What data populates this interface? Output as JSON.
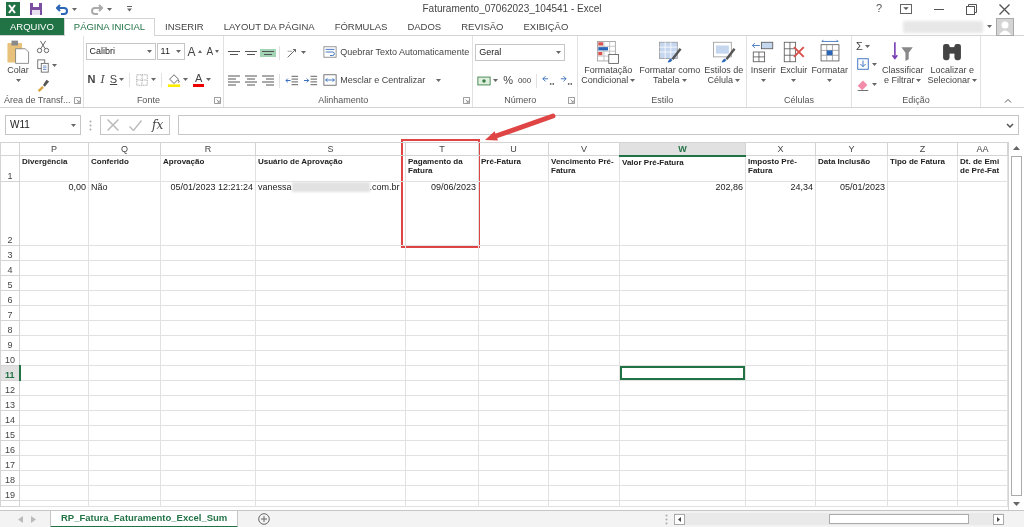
{
  "window": {
    "title": "Faturamento_07062023_104541 - Excel",
    "help": "?"
  },
  "tabs": [
    {
      "label": "ARQUIVO",
      "kind": "file",
      "selected": false
    },
    {
      "label": "PÁGINA INICIAL",
      "kind": "tab",
      "selected": true
    },
    {
      "label": "INSERIR",
      "kind": "tab",
      "selected": false
    },
    {
      "label": "LAYOUT DA PÁGINA",
      "kind": "tab",
      "selected": false
    },
    {
      "label": "FÓRMULAS",
      "kind": "tab",
      "selected": false
    },
    {
      "label": "DADOS",
      "kind": "tab",
      "selected": false
    },
    {
      "label": "REVISÃO",
      "kind": "tab",
      "selected": false
    },
    {
      "label": "EXIBIÇÃO",
      "kind": "tab",
      "selected": false
    }
  ],
  "ribbon": {
    "groups": [
      {
        "label": "Área de Transf...",
        "launcher": true,
        "blocks": [
          {
            "kind": "big",
            "lines": [
              "Colar"
            ],
            "caret": true
          },
          {
            "kind": "stack",
            "rows": [
              {
                "items": [
                  {
                    "kind": "icon"
                  }
                ]
              },
              {
                "items": [
                  {
                    "kind": "icon",
                    "caret": true
                  }
                ]
              },
              {
                "items": [
                  {
                    "kind": "icon"
                  }
                ]
              }
            ]
          }
        ]
      },
      {
        "label": "Fonte",
        "launcher": true,
        "blocks": [
          {
            "kind": "stack",
            "rows": [
              {
                "items": [
                  {
                    "kind": "combo",
                    "value": "Calibri"
                  },
                  {
                    "kind": "combo",
                    "value": "11"
                  },
                  {
                    "kind": "grow",
                    "label": "A"
                  },
                  {
                    "kind": "shrink",
                    "label": "A"
                  }
                ]
              },
              {
                "items": [
                  {
                    "kind": "bold",
                    "label": "N"
                  },
                  {
                    "kind": "italic",
                    "label": "I"
                  },
                  {
                    "kind": "underline",
                    "label": "S",
                    "caret": true
                  },
                  {
                    "kind": "sep"
                  },
                  {
                    "kind": "icon",
                    "caret": true
                  },
                  {
                    "kind": "sep"
                  },
                  {
                    "kind": "icon",
                    "caret": true
                  },
                  {
                    "kind": "fontcolor",
                    "label": "A",
                    "caret": true
                  }
                ]
              }
            ]
          }
        ]
      },
      {
        "label": "Alinhamento",
        "launcher": true,
        "blocks": [
          {
            "kind": "stack",
            "rows": [
              {
                "items": [
                  {
                    "kind": "icon",
                    "selected": false
                  },
                  {
                    "kind": "icon",
                    "selected": false
                  },
                  {
                    "kind": "icon",
                    "selected": true
                  },
                  {
                    "kind": "sep"
                  },
                  {
                    "kind": "icon",
                    "caret": true
                  }
                ]
              },
              {
                "items": [
                  {
                    "kind": "icon",
                    "selected": false
                  },
                  {
                    "kind": "icon",
                    "selected": false
                  },
                  {
                    "kind": "icon",
                    "selected": false
                  },
                  {
                    "kind": "sep"
                  },
                  {
                    "kind": "icon"
                  },
                  {
                    "kind": "icon"
                  }
                ]
              }
            ]
          },
          {
            "kind": "stack",
            "rows": [
              {
                "items": [
                  {
                    "kind": "wide",
                    "label": "Quebrar Texto Automaticamente"
                  }
                ]
              },
              {
                "items": [
                  {
                    "kind": "wide",
                    "label": "Mesclar e Centralizar",
                    "caret": true
                  }
                ]
              }
            ]
          }
        ]
      },
      {
        "label": "Número",
        "launcher": true,
        "blocks": [
          {
            "kind": "stack",
            "rows": [
              {
                "items": [
                  {
                    "kind": "combo",
                    "value": "Geral"
                  }
                ]
              },
              {
                "items": [
                  {
                    "kind": "icon",
                    "caret": true
                  },
                  {
                    "kind": "glyph",
                    "label": "%"
                  },
                  {
                    "kind": "small",
                    "label": "000"
                  },
                  {
                    "kind": "sep"
                  },
                  {
                    "kind": "icon"
                  },
                  {
                    "kind": "icon"
                  }
                ]
              }
            ]
          }
        ]
      },
      {
        "label": "Estilo",
        "blocks": [
          {
            "kind": "big",
            "lines": [
              "Formatação",
              "Condicional"
            ],
            "caret": true
          },
          {
            "kind": "big",
            "lines": [
              "Formatar como",
              "Tabela"
            ],
            "caret": true
          },
          {
            "kind": "big",
            "lines": [
              "Estilos de",
              "Célula"
            ],
            "caret": true
          }
        ]
      },
      {
        "label": "Células",
        "blocks": [
          {
            "kind": "big",
            "lines": [
              "Inserir"
            ],
            "caret": true
          },
          {
            "kind": "big",
            "lines": [
              "Excluir"
            ],
            "caret": true
          },
          {
            "kind": "big",
            "lines": [
              "Formatar"
            ],
            "caret": true
          }
        ]
      },
      {
        "label": "Edição",
        "blocks": [
          {
            "kind": "stack",
            "rows": [
              {
                "items": [
                  {
                    "kind": "glyph",
                    "label": "Σ",
                    "caret": true
                  }
                ]
              },
              {
                "items": [
                  {
                    "kind": "icon",
                    "caret": true
                  }
                ]
              },
              {
                "items": [
                  {
                    "kind": "icon",
                    "caret": true
                  }
                ]
              }
            ]
          },
          {
            "kind": "big",
            "lines": [
              "Classificar",
              "e Filtrar"
            ],
            "caret": true
          },
          {
            "kind": "big",
            "lines": [
              "Localizar e",
              "Selecionar"
            ],
            "caret": true
          }
        ]
      }
    ]
  },
  "formula_bar": {
    "name_box": "W11",
    "fx": "fx"
  },
  "sheet": {
    "columns": [
      {
        "letter": "P",
        "selected": false
      },
      {
        "letter": "Q",
        "selected": false
      },
      {
        "letter": "R",
        "selected": false
      },
      {
        "letter": "S",
        "selected": false
      },
      {
        "letter": "T",
        "selected": false
      },
      {
        "letter": "U",
        "selected": false
      },
      {
        "letter": "V",
        "selected": false
      },
      {
        "letter": "W",
        "selected": true
      },
      {
        "letter": "X",
        "selected": false
      },
      {
        "letter": "Y",
        "selected": false
      },
      {
        "letter": "Z",
        "selected": false
      },
      {
        "letter": "AA",
        "selected": false
      }
    ],
    "rows": [
      {
        "number": "1",
        "kind": "header",
        "selected": false,
        "cells": [
          {
            "kind": "text",
            "text": "Divergência"
          },
          {
            "kind": "text",
            "text": "Conferido"
          },
          {
            "kind": "text",
            "text": "Aprovação"
          },
          {
            "kind": "text",
            "text": "Usuário de Aprovação"
          },
          {
            "kind": "text",
            "text": "Pagamento da\nFatura"
          },
          {
            "kind": "text",
            "text": "Pré-Fatura"
          },
          {
            "kind": "text",
            "text": "Vencimento Pré-\nFatura"
          },
          {
            "kind": "text",
            "text": "Valor Pré-Fatura"
          },
          {
            "kind": "text",
            "text": "Imposto Pré-\nFatura"
          },
          {
            "kind": "text",
            "text": "Data Inclusão"
          },
          {
            "kind": "text",
            "text": "Tipo de Fatura"
          },
          {
            "kind": "text",
            "text": "Dt. de Emi\nde Pré-Fat"
          }
        ]
      },
      {
        "number": "2",
        "kind": "data",
        "selected": false,
        "cells": [
          {
            "kind": "number",
            "text": "0,00"
          },
          {
            "kind": "text",
            "text": "Não"
          },
          {
            "kind": "number",
            "text": "05/01/2023 12:21:24"
          },
          {
            "kind": "redacted",
            "parts": [
              "vanessa",
              ".com.br"
            ]
          },
          {
            "kind": "number",
            "text": "09/06/2023"
          },
          {
            "kind": "blank"
          },
          {
            "kind": "blank"
          },
          {
            "kind": "number",
            "text": "202,86"
          },
          {
            "kind": "number",
            "text": "24,34"
          },
          {
            "kind": "number",
            "text": "05/01/2023"
          },
          {
            "kind": "blank"
          },
          {
            "kind": "blank"
          }
        ]
      },
      {
        "number": "3",
        "kind": "empty",
        "selected": false
      },
      {
        "number": "4",
        "kind": "empty",
        "selected": false
      },
      {
        "number": "5",
        "kind": "empty",
        "selected": false
      },
      {
        "number": "6",
        "kind": "empty",
        "selected": false
      },
      {
        "number": "7",
        "kind": "empty",
        "selected": false
      },
      {
        "number": "8",
        "kind": "empty",
        "selected": false
      },
      {
        "number": "9",
        "kind": "empty",
        "selected": false
      },
      {
        "number": "10",
        "kind": "empty",
        "selected": false
      },
      {
        "number": "11",
        "kind": "empty",
        "selected": true
      },
      {
        "number": "12",
        "kind": "empty",
        "selected": false
      },
      {
        "number": "13",
        "kind": "empty",
        "selected": false
      },
      {
        "number": "14",
        "kind": "empty",
        "selected": false
      },
      {
        "number": "15",
        "kind": "empty",
        "selected": false
      },
      {
        "number": "16",
        "kind": "empty",
        "selected": false
      },
      {
        "number": "17",
        "kind": "empty",
        "selected": false
      },
      {
        "number": "18",
        "kind": "empty",
        "selected": false
      },
      {
        "number": "19",
        "kind": "empty",
        "selected": false
      }
    ]
  },
  "sheet_tabs": [
    {
      "label": "RP_Fatura_Faturamento_Excel_Sum",
      "selected": true
    }
  ]
}
